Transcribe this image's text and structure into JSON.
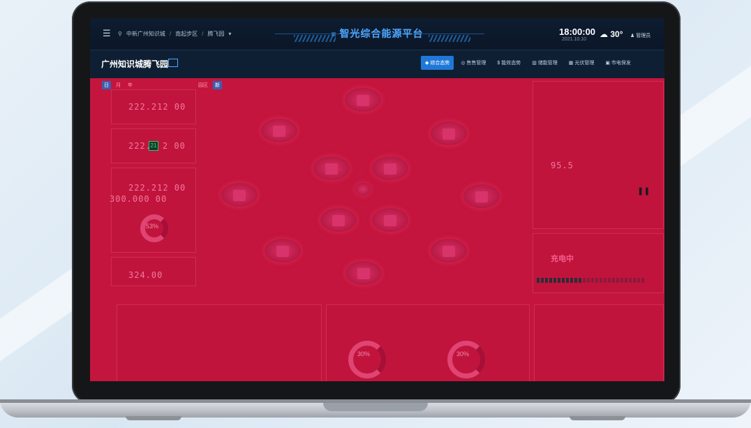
{
  "header": {
    "breadcrumb": [
      "中新广州知识城",
      "南起步区",
      "腾飞园"
    ],
    "app_title": "智光综合能源平台",
    "time": "18:00:00",
    "date": "2021.10.10",
    "temperature": "30°",
    "user": "管理员"
  },
  "subheader": {
    "park_name": "广州知识城腾飞园",
    "nav_tabs": [
      "综合态势",
      "售售管理",
      "能效态势",
      "储能管理",
      "光伏管理",
      "市电保发"
    ]
  },
  "content": {
    "left_tabs": [
      "日",
      "月",
      "年"
    ],
    "center_tabs": [
      "园区",
      "新"
    ],
    "metric_1": "222.212 00",
    "metric_2a": "222.",
    "metric_2_chip": "21",
    "metric_2b": "2 00",
    "metric_3": "222.212 00",
    "metric_3b": "300.000 00",
    "ring_left": "53%",
    "metric_4": "324.00",
    "right_value": "95.5",
    "status": "充电中",
    "donut_1": "30%",
    "donut_2": "30%"
  },
  "colors": {
    "accent": "#1f78d8",
    "overlay": "#c4153e",
    "title": "#4fa7ff"
  }
}
